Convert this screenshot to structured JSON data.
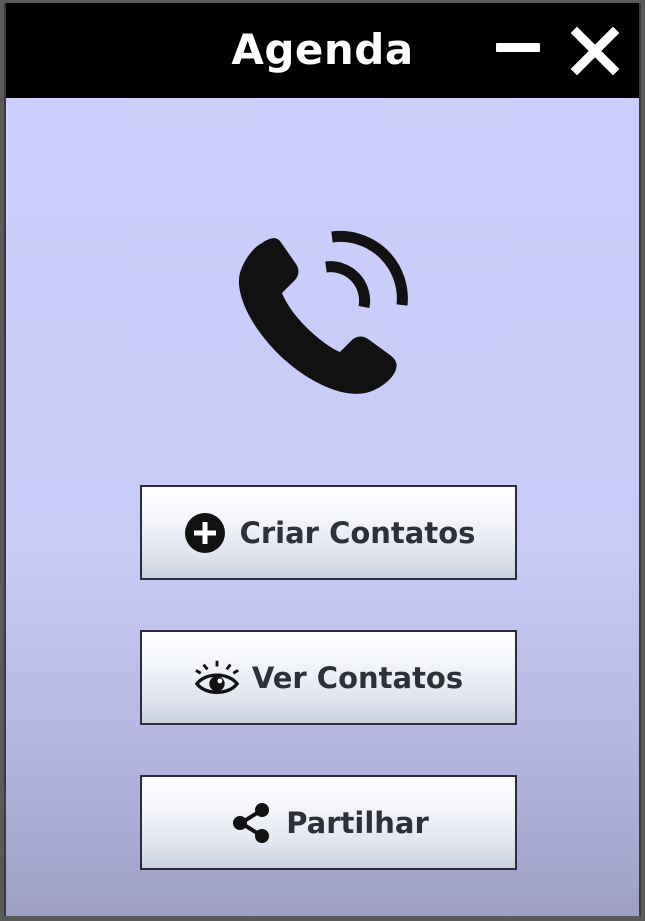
{
  "window": {
    "title": "Agenda",
    "controls": {
      "minimize_icon": "minimize-icon",
      "close_icon": "close-icon"
    },
    "background_color": "#cccffb",
    "titlebar_color": "#000000"
  },
  "hero": {
    "icon": "phone-icon"
  },
  "buttons": [
    {
      "label": "Criar Contatos",
      "icon": "plus-circle-icon"
    },
    {
      "label": "Ver Contatos",
      "icon": "eye-icon"
    },
    {
      "label": "Partilhar",
      "icon": "share-icon"
    }
  ]
}
